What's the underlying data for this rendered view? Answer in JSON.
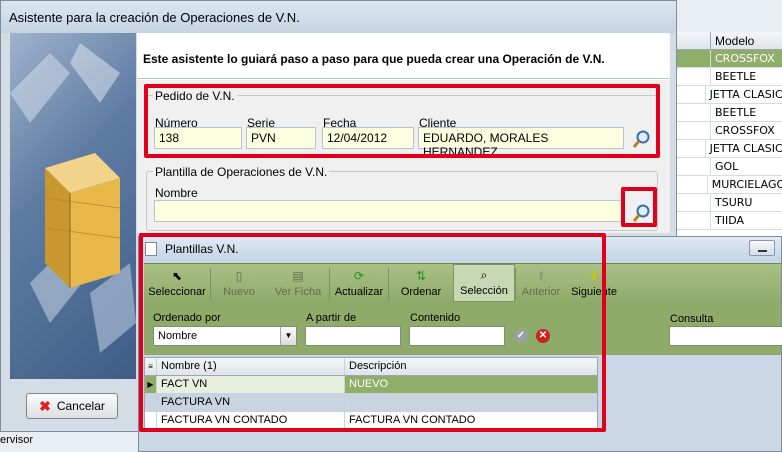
{
  "background": {
    "column_header": "Modelo",
    "models": [
      "CROSSFOX",
      "BEETLE",
      "JETTA CLASICO",
      "BEETLE",
      "CROSSFOX",
      "JETTA CLASICO",
      "GOL",
      "MURCIELAGO",
      "TSURU",
      "TIIDA"
    ],
    "bottom_text": "ervisor"
  },
  "wizard": {
    "title": "Asistente para la creación de Operaciones de V.N.",
    "intro": "Este asistente lo guiará paso a paso para que pueda crear una Operación de V.N.",
    "pedido": {
      "legend": "Pedido de V.N.",
      "numero_label": "Número",
      "numero": "138",
      "serie_label": "Serie",
      "serie": "PVN",
      "fecha_label": "Fecha",
      "fecha": "12/04/2012",
      "cliente_label": "Cliente",
      "cliente": "EDUARDO, MORALES HERNANDEZ"
    },
    "plantilla": {
      "legend": "Plantilla de Operaciones de V.N.",
      "nombre_label": "Nombre",
      "nombre": ""
    },
    "cancel_label": "Cancelar"
  },
  "plantillas": {
    "title": "Plantillas V.N.",
    "toolbar": [
      {
        "label": "Seleccionar",
        "icon": "cursor-icon",
        "enabled": true,
        "active": false
      },
      {
        "label": "Nuevo",
        "icon": "new-doc-icon",
        "enabled": false,
        "active": false
      },
      {
        "label": "Ver Ficha",
        "icon": "card-icon",
        "enabled": false,
        "active": false
      },
      {
        "label": "Actualizar",
        "icon": "refresh-icon",
        "enabled": true,
        "active": false
      },
      {
        "label": "Ordenar",
        "icon": "sort-icon",
        "enabled": true,
        "active": false
      },
      {
        "label": "Selección",
        "icon": "filter-search-icon",
        "enabled": true,
        "active": true
      },
      {
        "label": "Anterior",
        "icon": "up-arrow-icon",
        "enabled": false,
        "active": false
      },
      {
        "label": "Siguiente",
        "icon": "down-arrow-icon",
        "enabled": true,
        "active": false
      }
    ],
    "filter": {
      "ordenado_label": "Ordenado por",
      "ordenado_value": "Nombre",
      "apartir_label": "A partir de",
      "apartir_value": "",
      "contenido_label": "Contenido",
      "contenido_value": "",
      "consulta_label": "Consulta",
      "consulta_value": ""
    },
    "grid": {
      "columns": [
        "Nombre (1)",
        "Descripción"
      ],
      "rows": [
        {
          "nombre": "FACT VN",
          "descripcion": "NUEVO",
          "selected": true
        },
        {
          "nombre": "FACTURA VN",
          "descripcion": "",
          "selected": false
        },
        {
          "nombre": "FACTURA VN CONTADO",
          "descripcion": "FACTURA VN CONTADO",
          "selected": false
        }
      ]
    }
  },
  "colors": {
    "highlight": "#e0001b",
    "accent_green": "#8fae6a",
    "field_yellow": "#fdfde0"
  }
}
